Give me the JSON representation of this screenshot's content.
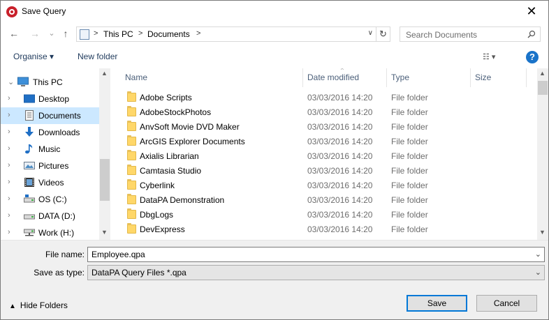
{
  "window": {
    "title": "Save Query",
    "close_glyph": "✕"
  },
  "nav": {
    "back_glyph": "←",
    "forward_glyph": "→",
    "recent_glyph": "⌄",
    "up_glyph": "↑",
    "address": {
      "sep1": ">",
      "part1": "This PC",
      "sep2": ">",
      "part2": "Documents",
      "sep3": ">",
      "dropdown_glyph": "∨",
      "refresh_glyph": "↻"
    },
    "search": {
      "placeholder": "Search Documents",
      "icon": "search-icon"
    }
  },
  "toolbar": {
    "organise": "Organise ▾",
    "new_folder": "New folder",
    "view_glyph": "☷ ▾",
    "help_glyph": "?"
  },
  "sidebar": {
    "items": [
      {
        "label": "This PC",
        "icon": "computer-icon",
        "chevron": "⌄",
        "selected": false
      },
      {
        "label": "Desktop",
        "icon": "desktop-icon",
        "chevron": "›",
        "selected": false
      },
      {
        "label": "Documents",
        "icon": "documents-icon",
        "chevron": "›",
        "selected": true
      },
      {
        "label": "Downloads",
        "icon": "downloads-icon",
        "chevron": "›",
        "selected": false
      },
      {
        "label": "Music",
        "icon": "music-icon",
        "chevron": "›",
        "selected": false
      },
      {
        "label": "Pictures",
        "icon": "pictures-icon",
        "chevron": "›",
        "selected": false
      },
      {
        "label": "Videos",
        "icon": "videos-icon",
        "chevron": "›",
        "selected": false
      },
      {
        "label": "OS (C:)",
        "icon": "drive-icon",
        "chevron": "›",
        "selected": false
      },
      {
        "label": "DATA (D:)",
        "icon": "drive-icon",
        "chevron": "›",
        "selected": false
      },
      {
        "label": "Work (H:)",
        "icon": "network-drive-icon",
        "chevron": "›",
        "selected": false
      }
    ],
    "scroll_up": "▲",
    "scroll_down": "▼"
  },
  "filelist": {
    "columns": {
      "name": "Name",
      "date": "Date modified",
      "type": "Type",
      "size": "Size"
    },
    "sort_caret": "^",
    "rows": [
      {
        "name": "Adobe Scripts",
        "date": "03/03/2016 14:20",
        "type": "File folder"
      },
      {
        "name": "AdobeStockPhotos",
        "date": "03/03/2016 14:20",
        "type": "File folder"
      },
      {
        "name": "AnvSoft Movie DVD Maker",
        "date": "03/03/2016 14:20",
        "type": "File folder"
      },
      {
        "name": "ArcGIS Explorer Documents",
        "date": "03/03/2016 14:20",
        "type": "File folder"
      },
      {
        "name": "Axialis Librarian",
        "date": "03/03/2016 14:20",
        "type": "File folder"
      },
      {
        "name": "Camtasia Studio",
        "date": "03/03/2016 14:20",
        "type": "File folder"
      },
      {
        "name": "Cyberlink",
        "date": "03/03/2016 14:20",
        "type": "File folder"
      },
      {
        "name": "DataPA Demonstration",
        "date": "03/03/2016 14:20",
        "type": "File folder"
      },
      {
        "name": "DbgLogs",
        "date": "03/03/2016 14:20",
        "type": "File folder"
      },
      {
        "name": "DevExpress",
        "date": "03/03/2016 14:20",
        "type": "File folder"
      }
    ],
    "scroll_up": "▲",
    "scroll_down": "▼"
  },
  "form": {
    "filename_label": "File name:",
    "filename_value": "Employee.qpa",
    "type_label": "Save as type:",
    "type_value": "DataPA Query Files *.qpa",
    "dropdown_glyph": "⌄"
  },
  "footer": {
    "hide_caret": "▲",
    "hide_folders": "Hide Folders",
    "save": "Save",
    "cancel": "Cancel"
  },
  "colors": {
    "selected_bg": "#cce8ff",
    "accent": "#0078d7",
    "title_icon": "#c8202a"
  }
}
